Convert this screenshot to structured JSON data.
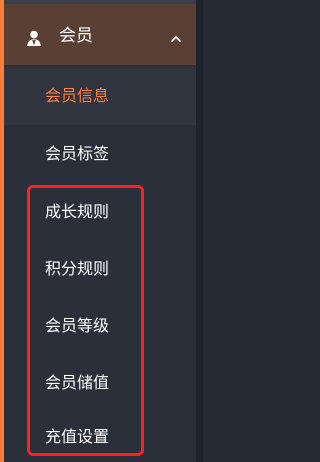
{
  "sidebar": {
    "group": {
      "label": "会员",
      "icon": "user-icon",
      "chevron": "chevron-up-icon"
    },
    "items": [
      {
        "label": "会员信息",
        "active": true
      },
      {
        "label": "会员标签",
        "active": false
      },
      {
        "label": "成长规则",
        "active": false
      },
      {
        "label": "积分规则",
        "active": false
      },
      {
        "label": "会员等级",
        "active": false
      },
      {
        "label": "会员储值",
        "active": false
      },
      {
        "label": "充值设置",
        "active": false
      }
    ]
  },
  "colors": {
    "accent": "#ff7d39",
    "background": "#2b2f39",
    "group_header": "#5a3f35",
    "highlight_box": "#ff1f1f"
  }
}
